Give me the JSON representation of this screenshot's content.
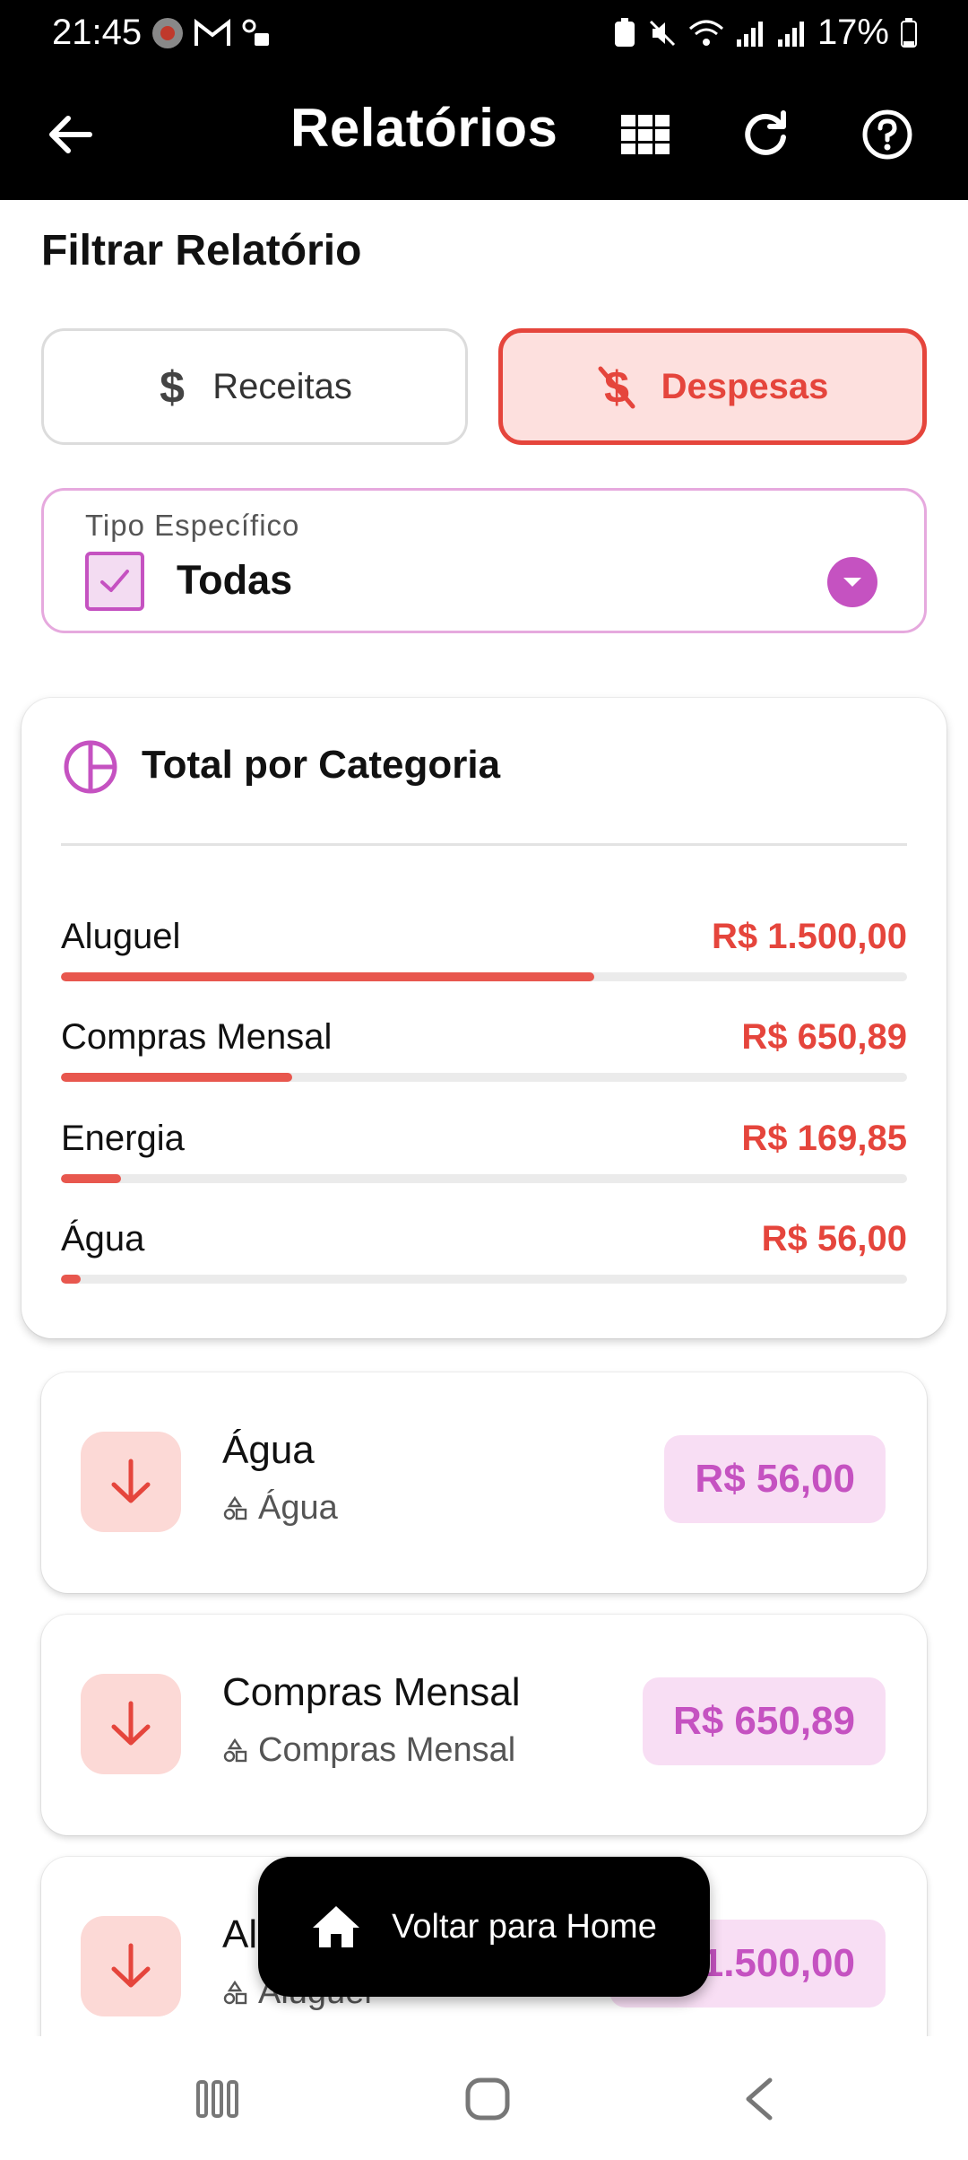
{
  "status_bar": {
    "time": "21:45",
    "battery": "17%"
  },
  "app_bar": {
    "title": "Relatórios"
  },
  "filter": {
    "title": "Filtrar Relatório",
    "income_label": "Receitas",
    "expense_label": "Despesas",
    "selected": "expense",
    "type_label": "Tipo Específico",
    "type_value": "Todas"
  },
  "category_card": {
    "title": "Total por Categoria",
    "items": [
      {
        "name": "Aluguel",
        "amount": "R$ 1.500,00",
        "share": 0.63
      },
      {
        "name": "Compras Mensal",
        "amount": "R$ 650,89",
        "share": 0.273
      },
      {
        "name": "Energia",
        "amount": "R$ 169,85",
        "share": 0.071
      },
      {
        "name": "Água",
        "amount": "R$ 56,00",
        "share": 0.023
      }
    ]
  },
  "transactions": [
    {
      "name": "Água",
      "category": "Água",
      "amount": "R$ 56,00"
    },
    {
      "name": "Compras Mensal",
      "category": "Compras Mensal",
      "amount": "R$ 650,89"
    },
    {
      "name": "Aluguel",
      "category": "Aluguel",
      "amount": "R$ 1.500,00"
    }
  ],
  "home_button": {
    "label": "Voltar para Home"
  },
  "colors": {
    "expense_red": "#e5453c",
    "accent_purple": "#c552c1",
    "bar_fill": "#e8574e"
  }
}
